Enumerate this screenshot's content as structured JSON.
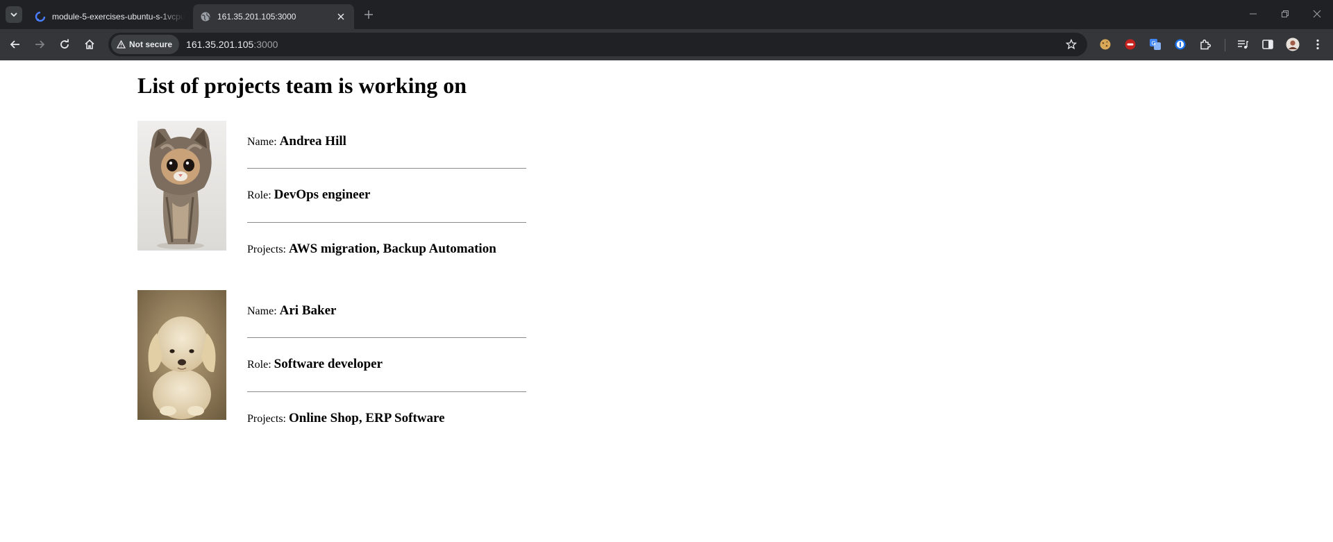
{
  "browser": {
    "tabs": [
      {
        "title": "module-5-exercises-ubuntu-s-1vcpu",
        "active": false,
        "favicon": "digitalocean-icon"
      },
      {
        "title": "161.35.201.105:3000",
        "active": true,
        "favicon": "globe-icon"
      }
    ],
    "security_label": "Not secure",
    "url_host": "161.35.201.105",
    "url_port": ":3000"
  },
  "page": {
    "heading": "List of projects team is working on",
    "members": [
      {
        "name_label": "Name:",
        "name": "Andrea Hill",
        "role_label": "Role:",
        "role": "DevOps engineer",
        "projects_label": "Projects:",
        "projects": "AWS migration, Backup Automation",
        "photo": "kitten-photo"
      },
      {
        "name_label": "Name:",
        "name": "Ari Baker",
        "role_label": "Role:",
        "role": "Software developer",
        "projects_label": "Projects:",
        "projects": "Online Shop, ERP Software",
        "photo": "puppy-photo"
      }
    ]
  },
  "colors": {
    "chrome_dark": "#202124",
    "chrome_toolbar": "#35363a",
    "page_bg": "#ffffff",
    "divider": "#8a8a8a"
  }
}
